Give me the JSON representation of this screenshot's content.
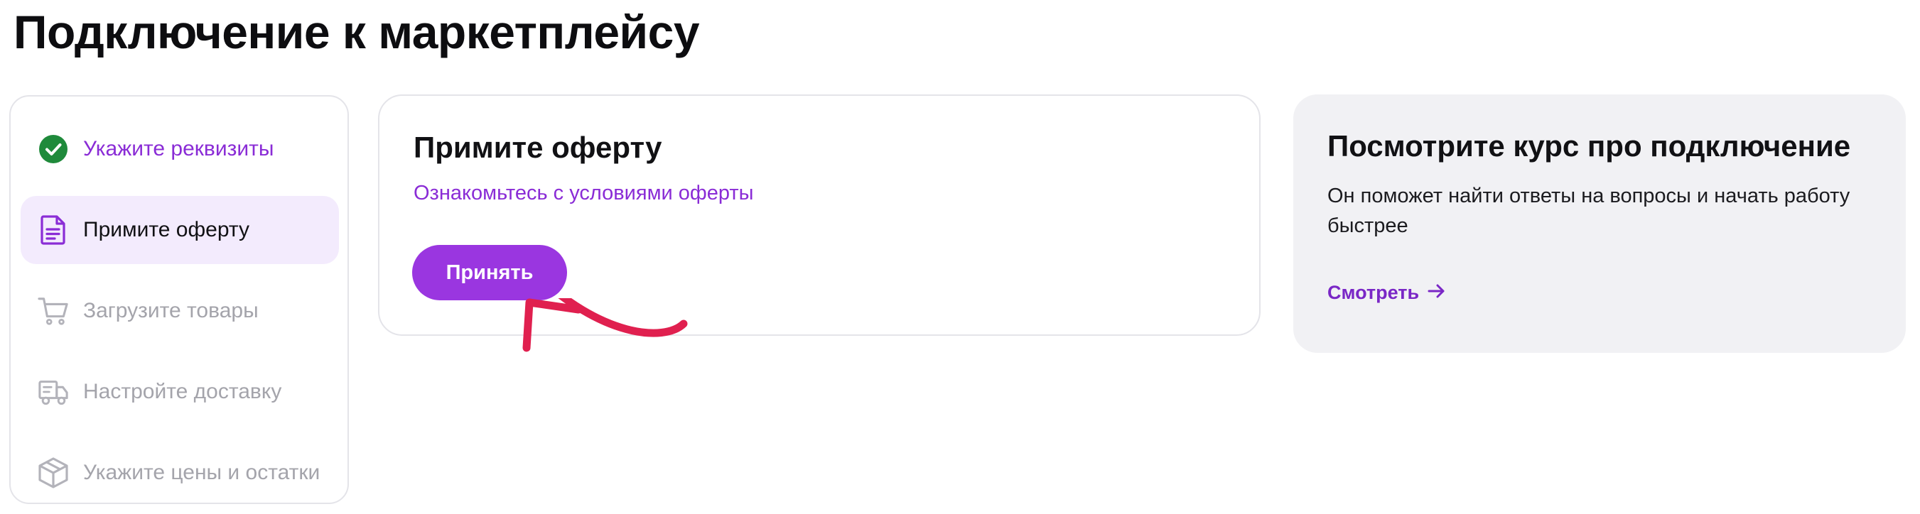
{
  "page": {
    "title": "Подключение к маркетплейсу"
  },
  "steps": [
    {
      "label": "Укажите реквизиты",
      "status": "done",
      "icon": "check-circle-icon"
    },
    {
      "label": "Примите оферту",
      "status": "active",
      "icon": "document-icon"
    },
    {
      "label": "Загрузите товары",
      "status": "disabled",
      "icon": "cart-icon"
    },
    {
      "label": "Настройте доставку",
      "status": "disabled",
      "icon": "truck-icon"
    },
    {
      "label": "Укажите цены и остатки",
      "status": "disabled",
      "icon": "box-icon"
    }
  ],
  "offer": {
    "title": "Примите оферту",
    "link_label": "Ознакомьтесь с условиями оферты",
    "accept_label": "Принять"
  },
  "course": {
    "title": "Посмотрите курс про подключение",
    "description": "Он поможет найти ответы на вопросы и начать работу быстрее",
    "link_label": "Смотреть"
  },
  "colors": {
    "accent": "#9a36e0",
    "link": "#8a2cd6",
    "success": "#1f8a3b",
    "active_step_bg": "#f3ebfd",
    "hint_arrow": "#e0204f"
  }
}
